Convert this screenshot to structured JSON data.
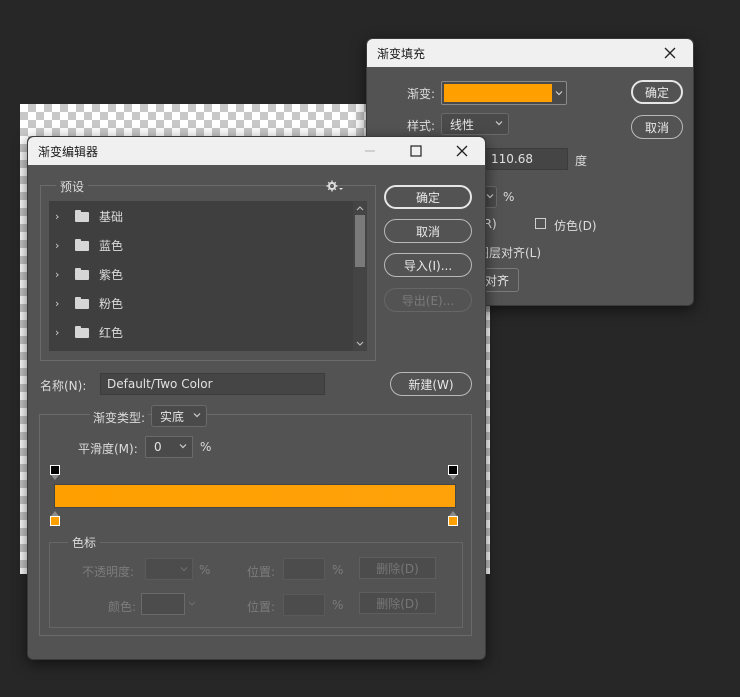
{
  "fill_dialog": {
    "title": "渐变填充",
    "gradient_label": "渐变:",
    "style_label": "样式:",
    "style_value": "线性",
    "angle_value": "110.68",
    "angle_unit": "度",
    "percent_unit": "%",
    "reverse_label": "(R)",
    "dither_label": "仿色(D)",
    "align_layer_label": "图层对齐(L)",
    "align_button": "对齐",
    "ok": "确定",
    "cancel": "取消"
  },
  "editor": {
    "title": "渐变编辑器",
    "presets_label": "预设",
    "presets": [
      {
        "name": "基础"
      },
      {
        "name": "蓝色"
      },
      {
        "name": "紫色"
      },
      {
        "name": "粉色"
      },
      {
        "name": "红色"
      }
    ],
    "ok": "确定",
    "cancel": "取消",
    "import": "导入(I)...",
    "export": "导出(E)...",
    "name_label": "名称(N):",
    "name_value": "Default/Two Color",
    "new_button": "新建(W)",
    "gradient_type_label": "渐变类型:",
    "gradient_type_value": "实底",
    "smoothness_label": "平滑度(M):",
    "smoothness_value": "0",
    "smoothness_unit": "%",
    "stops_group_label": "色标",
    "opacity_label": "不透明度:",
    "opacity_unit": "%",
    "location_label": "位置:",
    "location_unit": "%",
    "delete_label": "删除(D)",
    "color_label": "颜色:",
    "colors": {
      "gradient_start": "#ff9f00",
      "gradient_end": "#ffa20a",
      "stop": "#ff9f00"
    }
  }
}
